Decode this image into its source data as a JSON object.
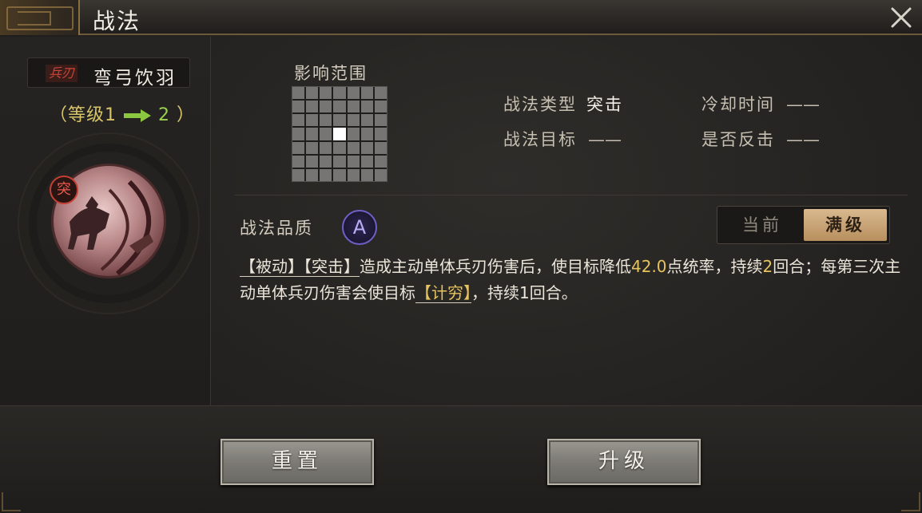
{
  "window": {
    "title": "战法",
    "close_icon": "close-icon"
  },
  "skill": {
    "type_tag": "兵刃",
    "name": "弯弓饮羽",
    "level": {
      "open": "（等级1",
      "to": "2",
      "close": "）"
    },
    "badge": "突",
    "icon": "archer-cavalry-icon"
  },
  "range": {
    "label": "影响范围",
    "grid_size": 7,
    "highlighted_cell": 24
  },
  "info": {
    "type_label": "战法类型",
    "type_value": "突击",
    "cooldown_label": "冷却时间",
    "cooldown_value": "——",
    "target_label": "战法目标",
    "target_value": "——",
    "counter_label": "是否反击",
    "counter_value": "——"
  },
  "quality": {
    "label": "战法品质",
    "value": "A"
  },
  "toggle": {
    "current": "当前",
    "max": "满级"
  },
  "description": {
    "tag1": "【被动】",
    "tag2": "【突击】",
    "part1": "造成主动单体兵刃伤害后，使目标降低",
    "value1": "42.0",
    "part2": "点统率，持续",
    "value2": "2",
    "part3": "回合；每第三次主动单体兵刃伤害会使目标",
    "tag3": "【计穷】",
    "part4": "，持续1回合。"
  },
  "buttons": {
    "reset": "重置",
    "upgrade": "升级"
  },
  "colors": {
    "accent_gold": "#e6c35f",
    "level_green": "#9ad24f",
    "type_red": "#c9463b",
    "quality_purple": "#6f5fc9"
  }
}
